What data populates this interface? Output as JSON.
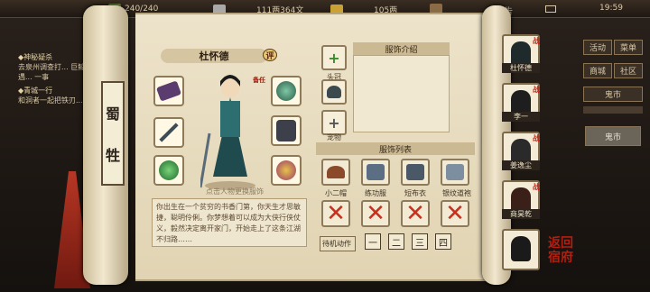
{
  "status_bar": {
    "stamina": "240/240",
    "silver": "111两364文",
    "gold": "105两",
    "announcement_label": "公告",
    "clock": "19:59"
  },
  "quests": {
    "q1_title": "◆神秘疑杀",
    "q1_body": "去泉州调查打... 巨鲸帮弟子遇... 一事",
    "q2_title": "◆青城一行",
    "q2_body": "和洞者一起把铁刃..."
  },
  "roller": {
    "char1": "蜀",
    "char2": "牲"
  },
  "character": {
    "name": "杜怀德",
    "eval_label": "评",
    "beiyu_label": "备任",
    "hint": "点击人物更换服饰",
    "bio": "你出生在一个贫穷的书香门第，你天生才思敏捷，聪明伶俐。你梦想着可以成为大侠行侠仗义，毅然决定离开家门，开始走上了这条江湖不归路……"
  },
  "equip_slots": [
    {
      "label": "头冠",
      "icon": "plus-icon"
    },
    {
      "label": "",
      "icon": "helmet-icon"
    },
    {
      "label": "宠物",
      "icon": "plus-icon"
    }
  ],
  "panels": {
    "info_title": "服饰介绍",
    "list_title": "服饰列表"
  },
  "outfits": [
    {
      "label": "小二帽",
      "icon": "hat-icon",
      "locked": false
    },
    {
      "label": "练功服",
      "icon": "outfit-icon",
      "locked": false
    },
    {
      "label": "短布衣",
      "icon": "outfit-icon",
      "locked": false
    },
    {
      "label": "银纹道袍",
      "icon": "outfit-icon",
      "locked": false
    },
    {
      "label": "",
      "icon": "locked-x-icon",
      "locked": true
    },
    {
      "label": "",
      "icon": "locked-x-icon",
      "locked": true
    },
    {
      "label": "",
      "icon": "locked-x-icon",
      "locked": true
    },
    {
      "label": "",
      "icon": "locked-x-icon",
      "locked": true
    }
  ],
  "idle_actions": {
    "label": "待机动作",
    "options": [
      "一",
      "二",
      "三",
      "四"
    ]
  },
  "roster": [
    {
      "name": "杜怀德",
      "tag": "战"
    },
    {
      "name": "李一",
      "tag": "战"
    },
    {
      "name": "姜逸尘",
      "tag": "战"
    },
    {
      "name": "商昊乾",
      "tag": "战"
    },
    {
      "name": "",
      "tag": ""
    }
  ],
  "menu": {
    "activity": "活动",
    "menu": "菜单",
    "shop": "商城",
    "social": "社区",
    "tab": "鬼市",
    "entry": "鬼市"
  },
  "back_label": "返回宿府",
  "colors": {
    "accent_red": "#c7301e",
    "parchment": "#e9dfc5",
    "plus_green": "#3b8b2f"
  }
}
